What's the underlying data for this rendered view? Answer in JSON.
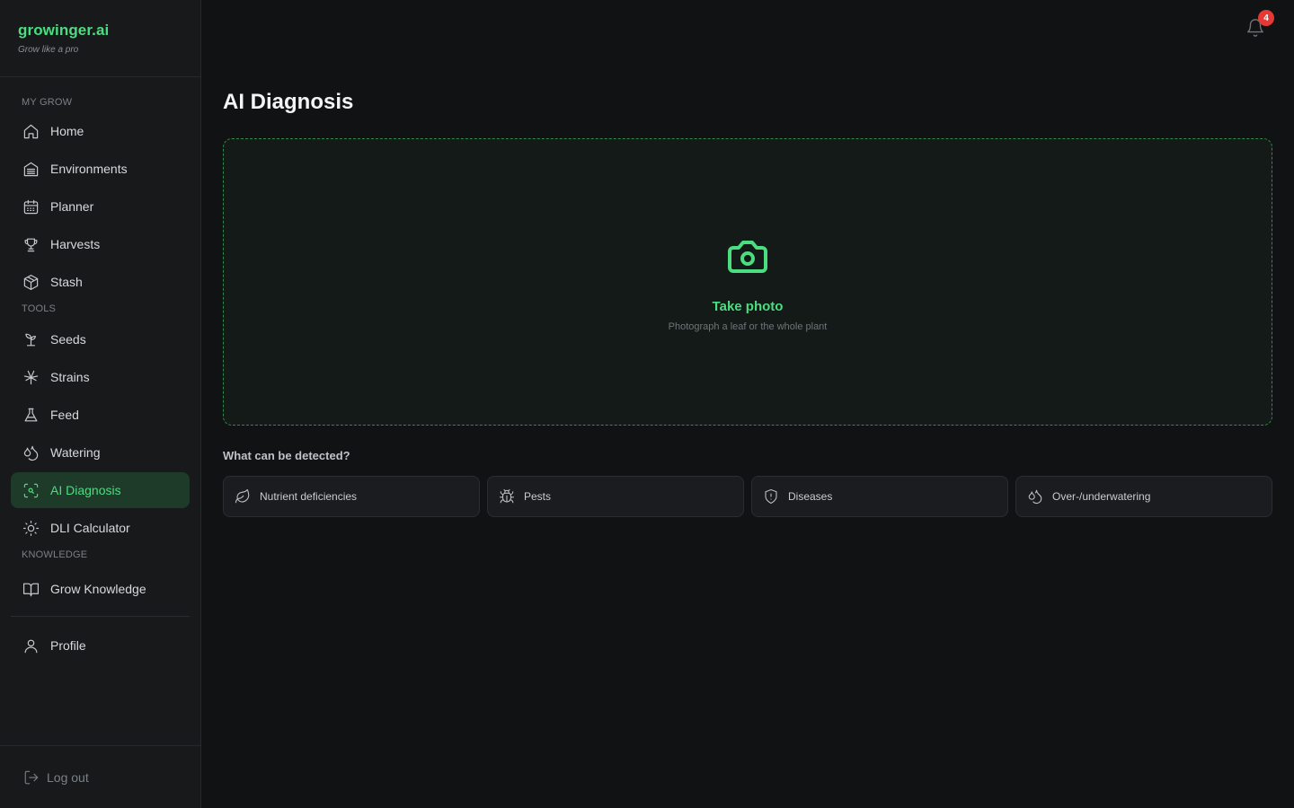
{
  "brand": {
    "name": "growinger.ai",
    "tagline": "Grow like a pro"
  },
  "sidebar": {
    "sections": [
      {
        "label": "MY GROW"
      },
      {
        "label": "TOOLS"
      },
      {
        "label": "KNOWLEDGE"
      }
    ],
    "my_grow": [
      {
        "label": "Home",
        "icon": "home-icon"
      },
      {
        "label": "Environments",
        "icon": "environments-icon"
      },
      {
        "label": "Planner",
        "icon": "calendar-icon"
      },
      {
        "label": "Harvests",
        "icon": "trophy-icon"
      },
      {
        "label": "Stash",
        "icon": "box-icon"
      }
    ],
    "tools": [
      {
        "label": "Seeds",
        "icon": "sprout-icon"
      },
      {
        "label": "Strains",
        "icon": "leaf-icon"
      },
      {
        "label": "Feed",
        "icon": "flask-icon"
      },
      {
        "label": "Watering",
        "icon": "droplets-icon"
      },
      {
        "label": "AI Diagnosis",
        "icon": "scan-icon",
        "active": true
      },
      {
        "label": "DLI Calculator",
        "icon": "sun-icon"
      }
    ],
    "knowledge": [
      {
        "label": "Grow Knowledge",
        "icon": "book-icon"
      }
    ],
    "profile": {
      "label": "Profile",
      "icon": "user-icon"
    },
    "logout": {
      "label": "Log out",
      "icon": "logout-icon"
    }
  },
  "header": {
    "notification_count": "4",
    "accent": "#4ade80",
    "badge_color": "#e53935"
  },
  "main": {
    "title": "AI Diagnosis",
    "dropzone": {
      "title": "Take photo",
      "subtitle": "Photograph a leaf or the whole plant",
      "icon": "camera-icon"
    },
    "detect_title": "What can be detected?",
    "detect_items": [
      {
        "label": "Nutrient deficiencies",
        "icon": "leaf-icon"
      },
      {
        "label": "Pests",
        "icon": "bug-icon"
      },
      {
        "label": "Diseases",
        "icon": "shield-alert-icon"
      },
      {
        "label": "Over-/underwatering",
        "icon": "droplets-icon"
      }
    ]
  }
}
